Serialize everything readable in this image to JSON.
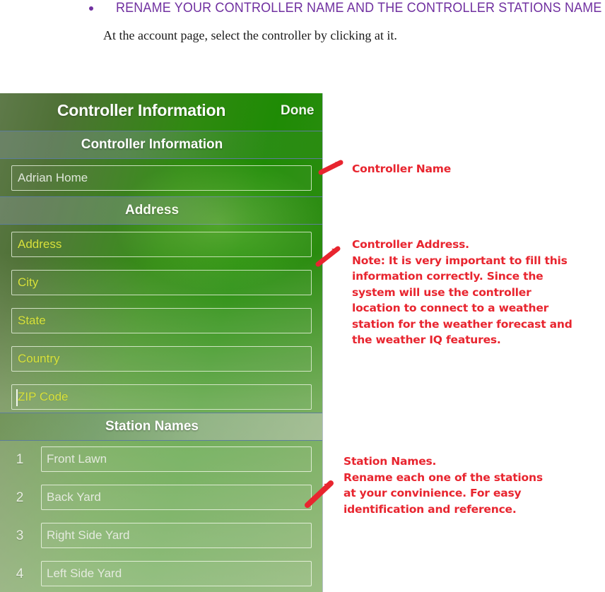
{
  "document": {
    "bullet_heading": "RENAME YOUR CONTROLLER NAME AND THE CONTROLLER STATIONS NAME",
    "sub_line": "At the account page, select the controller by clicking at it."
  },
  "app": {
    "navbar": {
      "title": "Controller Information",
      "done_label": "Done"
    },
    "sections": [
      {
        "id": "controller-information",
        "label": "Controller Information"
      },
      {
        "id": "address",
        "label": "Address"
      },
      {
        "id": "station-names",
        "label": "Station Names"
      }
    ],
    "controller_name_field": {
      "value": "Adrian Home",
      "placeholder": "Controller Name"
    },
    "address_fields": [
      {
        "name": "address",
        "placeholder": "Address",
        "value": ""
      },
      {
        "name": "city",
        "placeholder": "City",
        "value": ""
      },
      {
        "name": "state",
        "placeholder": "State",
        "value": ""
      },
      {
        "name": "country",
        "placeholder": "Country",
        "value": ""
      },
      {
        "name": "zip-code",
        "placeholder": "ZIP Code",
        "value": "",
        "focused": true
      }
    ],
    "stations": [
      {
        "number": "1",
        "name": "Front Lawn"
      },
      {
        "number": "2",
        "name": "Back Yard"
      },
      {
        "number": "3",
        "name": "Right Side Yard"
      },
      {
        "number": "4",
        "name": "Left Side Yard"
      }
    ]
  },
  "annotations": [
    {
      "id": "controller-name",
      "text": "Controller Name"
    },
    {
      "id": "controller-address",
      "text": "Controller Address.\nNote: It is very important to fill this\ninformation correctly. Since the\nsystem will use the controller\nlocation to connect to a weather\nstation for the weather forecast and\nthe weather IQ features."
    },
    {
      "id": "station-names",
      "text": "Station Names.\nRename each one of the stations\nat your convinience. For easy\nidentification and reference."
    }
  ],
  "colors": {
    "heading_purple": "#7030A0",
    "annotation_red": "#E8252F",
    "placeholder_yellow": "#D7E13F",
    "placeholder_white": "#DFE6DA",
    "app_green": "#1F8B05",
    "band_border": "#5D7D9B"
  }
}
